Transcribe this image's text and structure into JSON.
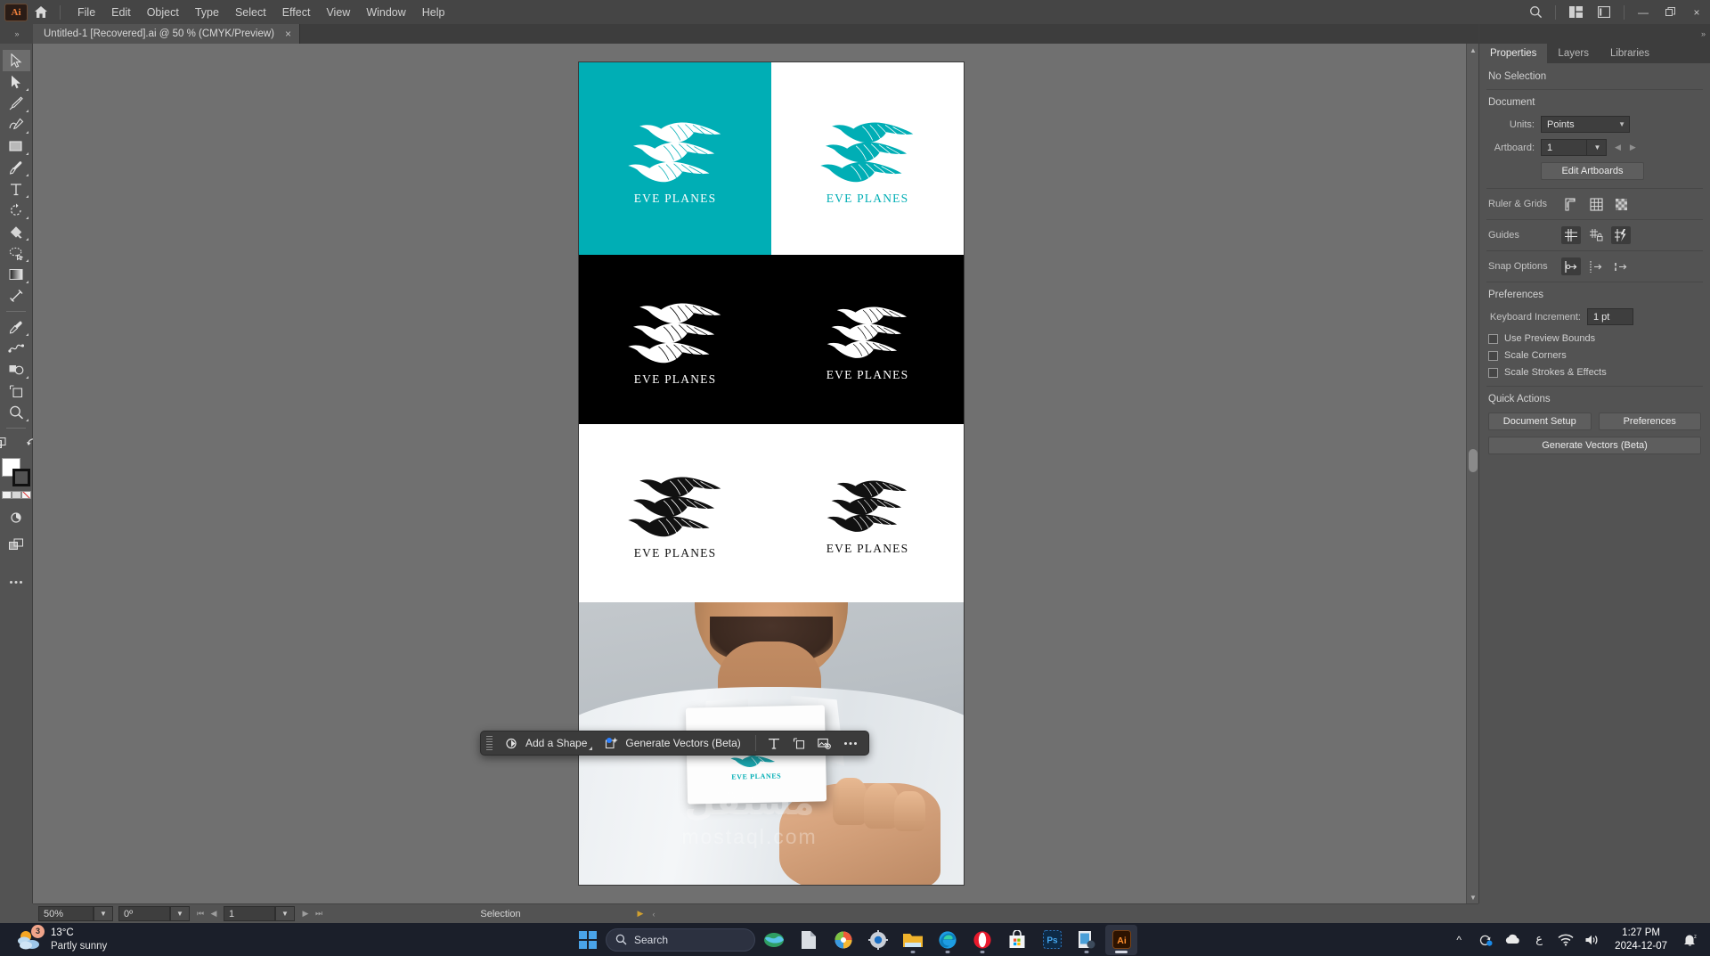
{
  "app": {
    "name": "Adobe Illustrator",
    "logo_text": "Ai",
    "accent_teal": "#00aeb5",
    "menu": [
      "File",
      "Edit",
      "Object",
      "Type",
      "Select",
      "Effect",
      "View",
      "Window",
      "Help"
    ]
  },
  "document_tab": {
    "title": "Untitled-1 [Recovered].ai @ 50 % (CMYK/Preview)",
    "close": "×"
  },
  "window_controls": {
    "minimize": "—",
    "restore": "❐",
    "close": "×"
  },
  "toolbar": {
    "tools": [
      {
        "name": "selection-tool",
        "glyph": "selection"
      },
      {
        "name": "direct-selection-tool",
        "glyph": "direct-selection"
      },
      {
        "name": "pen-tool",
        "glyph": "pen"
      },
      {
        "name": "curvature-tool",
        "glyph": "curvature"
      },
      {
        "name": "rectangle-tool",
        "glyph": "rectangle"
      },
      {
        "name": "paintbrush-tool",
        "glyph": "brush"
      },
      {
        "name": "type-tool",
        "glyph": "type"
      },
      {
        "name": "rotate-tool",
        "glyph": "rotate"
      },
      {
        "name": "gradient-mesh-tool",
        "glyph": "mesh"
      },
      {
        "name": "lasso-tool",
        "glyph": "lasso"
      },
      {
        "name": "gradient-tool",
        "glyph": "gradient"
      },
      {
        "name": "width-tool",
        "glyph": "width"
      },
      {
        "name": "eyedropper-tool",
        "glyph": "eyedropper"
      },
      {
        "name": "blend-tool",
        "glyph": "blend"
      },
      {
        "name": "shape-builder-tool",
        "glyph": "shapebuilder"
      },
      {
        "name": "artboard-tool",
        "glyph": "artboard"
      },
      {
        "name": "zoom-tool",
        "glyph": "zoom"
      }
    ],
    "bottom": [
      {
        "name": "edit-toolbar-button",
        "glyph": "edittoolbar"
      },
      {
        "name": "swap-fill-stroke-button",
        "glyph": "swap"
      },
      {
        "name": "change-screen-mode-button",
        "glyph": "screenmode"
      },
      {
        "name": "arrange-documents-button",
        "glyph": "arrange"
      },
      {
        "name": "more-tools-button",
        "glyph": "ellipsis"
      }
    ],
    "fill_color": "#ffffff",
    "stroke_color": "#000000"
  },
  "artboard": {
    "brand_name": "EVE PLANES",
    "panels": [
      {
        "name": "logo-teal-background",
        "bg": "#00aeb5",
        "mark_color": "#ffffff",
        "text_color": "#ffffff"
      },
      {
        "name": "logo-white-background",
        "bg": "#ffffff",
        "mark_color": "#00aeb5",
        "text_color": "#00aeb5"
      },
      {
        "name": "logo-black-background-left",
        "bg": "#000000",
        "mark_color": "#ffffff",
        "text_color": "#ffffff"
      },
      {
        "name": "logo-black-background-right",
        "bg": "#000000",
        "mark_color": "#ffffff",
        "text_color": "#ffffff"
      },
      {
        "name": "logo-black-mark-left",
        "bg": "#ffffff",
        "mark_color": "#111111",
        "text_color": "#111111"
      },
      {
        "name": "logo-black-mark-right",
        "bg": "#ffffff",
        "mark_color": "#111111",
        "text_color": "#111111"
      }
    ],
    "mockup": {
      "name": "business-card-mockup",
      "card_text": "EVE PLANES",
      "card_mark_color": "#1aa3ab"
    }
  },
  "watermark": {
    "arabic": "مستقل",
    "latin": "mostaql.com"
  },
  "contextual_taskbar": {
    "add_shape_label": "Add a Shape",
    "generate_vectors_label": "Generate Vectors (Beta)",
    "icons": [
      "type-tool-icon",
      "artboard-icon",
      "place-image-icon",
      "more-options-icon"
    ]
  },
  "status_bar": {
    "zoom": "50%",
    "rotation": "0º",
    "artboard_number": "1",
    "status_text": "Selection"
  },
  "properties_panel": {
    "tabs": [
      {
        "label": "Properties",
        "active": true
      },
      {
        "label": "Layers",
        "active": false
      },
      {
        "label": "Libraries",
        "active": false
      }
    ],
    "selection_state": "No Selection",
    "document": {
      "title": "Document",
      "units_label": "Units:",
      "units_value": "Points",
      "artboard_label": "Artboard:",
      "artboard_value": "1",
      "edit_artboards_label": "Edit Artboards"
    },
    "ruler_grids": {
      "label": "Ruler & Grids",
      "icons": [
        "show-rulers-icon",
        "show-grid-icon",
        "show-transparency-grid-icon"
      ]
    },
    "guides": {
      "label": "Guides",
      "icons": [
        "show-guides-icon",
        "lock-guides-icon",
        "smart-guides-icon"
      ]
    },
    "snap_options": {
      "label": "Snap Options",
      "icons": [
        "snap-to-point-icon",
        "snap-to-grid-icon",
        "snap-to-pixel-icon"
      ]
    },
    "preferences": {
      "title": "Preferences",
      "keyboard_increment_label": "Keyboard Increment:",
      "keyboard_increment_value": "1 pt",
      "checkboxes": [
        {
          "label": "Use Preview Bounds",
          "checked": false
        },
        {
          "label": "Scale Corners",
          "checked": false
        },
        {
          "label": "Scale Strokes & Effects",
          "checked": false
        }
      ]
    },
    "quick_actions": {
      "title": "Quick Actions",
      "document_setup_label": "Document Setup",
      "preferences_label": "Preferences",
      "generate_vectors_label": "Generate Vectors (Beta)"
    }
  },
  "taskbar": {
    "weather": {
      "temperature": "13°C",
      "description": "Partly sunny",
      "badge": "3"
    },
    "search_placeholder": "Search",
    "apps": [
      {
        "name": "taskbar-app-earth",
        "running": false
      },
      {
        "name": "taskbar-app-file-explorer",
        "running": false
      },
      {
        "name": "taskbar-app-paint",
        "running": false
      },
      {
        "name": "taskbar-app-settings",
        "running": false
      },
      {
        "name": "taskbar-app-folder",
        "running": true
      },
      {
        "name": "taskbar-app-edge",
        "running": true
      },
      {
        "name": "taskbar-app-opera",
        "running": true
      },
      {
        "name": "taskbar-app-store",
        "running": false
      },
      {
        "name": "taskbar-app-photoshop",
        "running": false
      },
      {
        "name": "taskbar-app-capture",
        "running": true
      },
      {
        "name": "taskbar-app-illustrator",
        "running": true
      }
    ],
    "tray": {
      "language": "ع",
      "time": "1:27 PM",
      "date": "2024-12-07"
    }
  }
}
